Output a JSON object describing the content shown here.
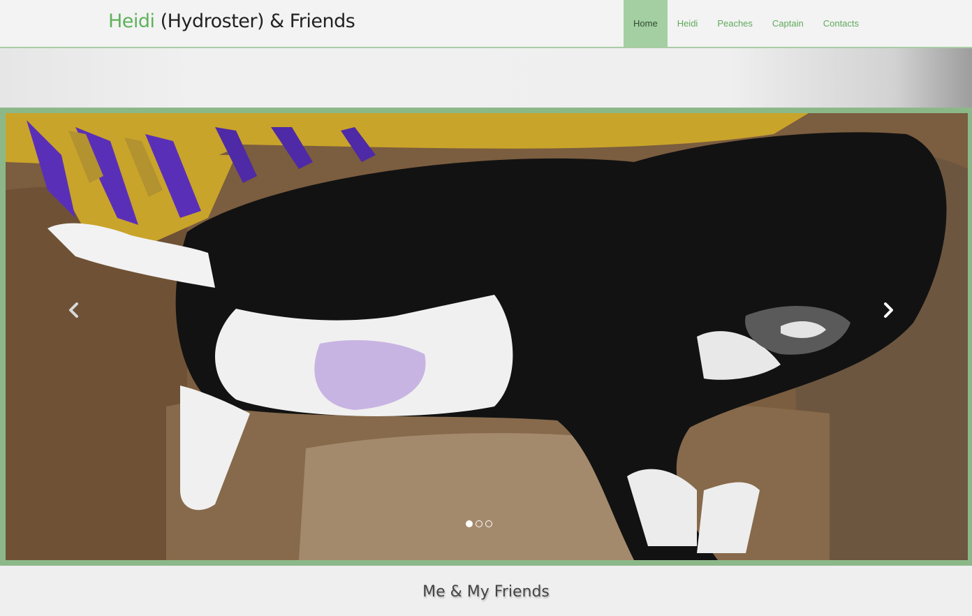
{
  "brand": {
    "accent": "Heidi",
    "rest": " (Hydroster) & Friends"
  },
  "nav": {
    "items": [
      {
        "label": "Home",
        "active": true
      },
      {
        "label": "Heidi",
        "active": false
      },
      {
        "label": "Peaches",
        "active": false
      },
      {
        "label": "Captain",
        "active": false
      },
      {
        "label": "Contacts",
        "active": false
      }
    ]
  },
  "carousel": {
    "prev_icon": "chevron-left-icon",
    "next_icon": "chevron-right-icon",
    "indicators": [
      {
        "active": true
      },
      {
        "active": false
      },
      {
        "active": false
      }
    ]
  },
  "section": {
    "title": "Me & My Friends"
  },
  "colors": {
    "accent": "#5fb25c",
    "nav_active_bg": "#a3cfa2",
    "frame": "#8cb889"
  }
}
